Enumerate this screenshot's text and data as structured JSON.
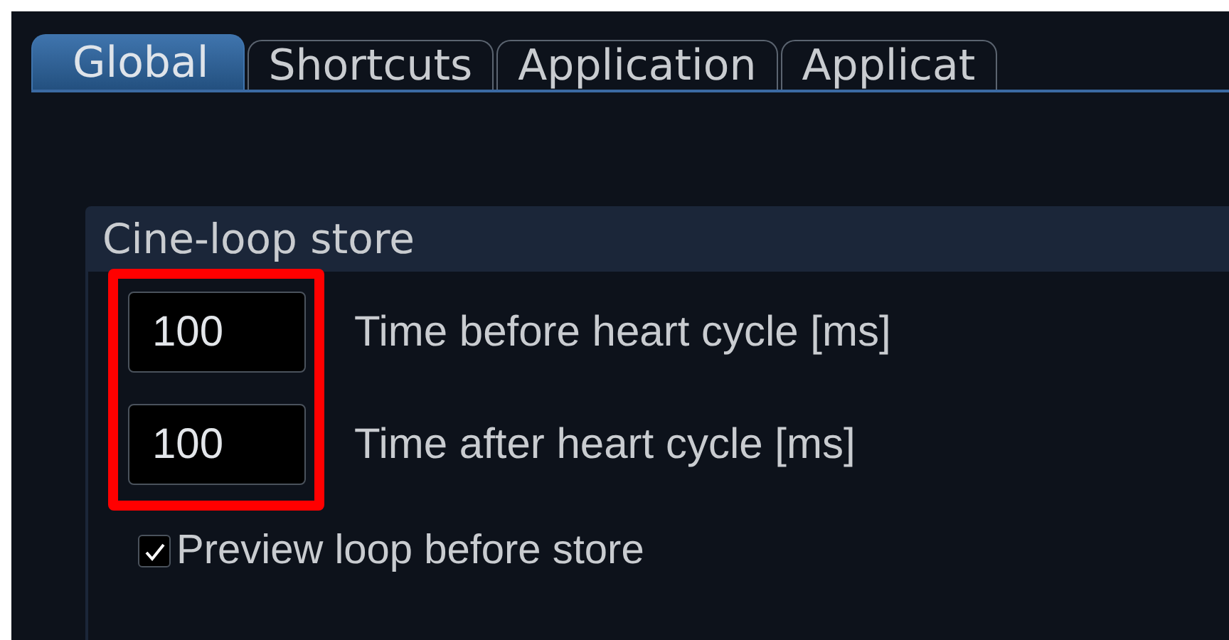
{
  "tabs": [
    {
      "label": "Global",
      "selected": true
    },
    {
      "label": "Shortcuts",
      "selected": false
    },
    {
      "label": "Application",
      "selected": false
    },
    {
      "label": "Applicat",
      "selected": false
    }
  ],
  "group": {
    "title": "Cine-loop store",
    "fields": [
      {
        "value": "100",
        "label": "Time before heart cycle [ms]"
      },
      {
        "value": "100",
        "label": "Time after heart cycle [ms]"
      }
    ],
    "checkbox": {
      "label": "Preview loop before store",
      "checked": true
    },
    "highlighted": true
  }
}
